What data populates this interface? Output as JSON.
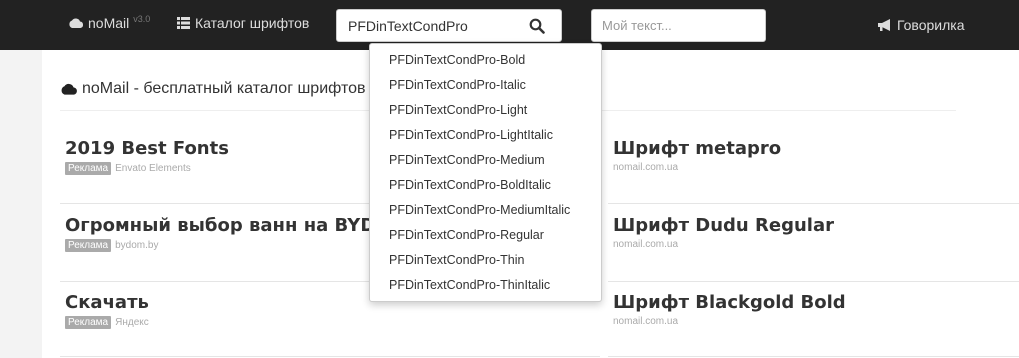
{
  "navbar": {
    "brand": "noMail",
    "version": "v3.0",
    "catalog_label": "Каталог шрифтов",
    "search_value": "PFDinTextCondPro",
    "mytext_placeholder": "Мой текст...",
    "talker_label": "Говорилка"
  },
  "main": {
    "headline": "noMail - бесплатный каталог шрифтов"
  },
  "ads_left": [
    {
      "title": "2019 Best Fonts",
      "badge": "Реклама",
      "source": "Envato Elements"
    },
    {
      "title": "Огромный выбор ванн на BYD",
      "badge": "Реклама",
      "source": "bydom.by"
    },
    {
      "title": "Скачать",
      "badge": "Реклама",
      "source": "Яндекс"
    }
  ],
  "ads_right": [
    {
      "title": "Шрифт metapro",
      "source": "nomail.com.ua"
    },
    {
      "title": "Шрифт Dudu Regular",
      "source": "nomail.com.ua"
    },
    {
      "title": "Шрифт Blackgold Bold",
      "source": "nomail.com.ua"
    }
  ],
  "suggestions": [
    "PFDinTextCondPro-Bold",
    "PFDinTextCondPro-Italic",
    "PFDinTextCondPro-Light",
    "PFDinTextCondPro-LightItalic",
    "PFDinTextCondPro-Medium",
    "PFDinTextCondPro-BoldItalic",
    "PFDinTextCondPro-MediumItalic",
    "PFDinTextCondPro-Regular",
    "PFDinTextCondPro-Thin",
    "PFDinTextCondPro-ThinItalic"
  ],
  "colors": {
    "navbar": "#222222",
    "background": "#f3f3f3",
    "badge": "#aaaaaa"
  }
}
